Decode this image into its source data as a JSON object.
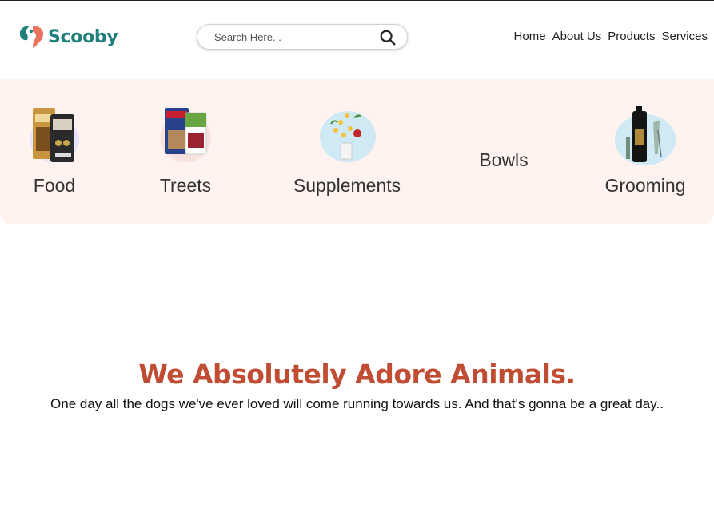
{
  "brand": {
    "name": "Scooby",
    "logo_icon": "heart-paw-logo",
    "primary_color": "#1f7f7a",
    "accent_color": "#e9735d"
  },
  "search": {
    "placeholder": "Search Here. .",
    "icon": "search-icon"
  },
  "nav": {
    "items": [
      {
        "label": "Home"
      },
      {
        "label": "About Us"
      },
      {
        "label": "Products"
      },
      {
        "label": "Services"
      }
    ]
  },
  "categories": {
    "background": "#fef3ef",
    "items": [
      {
        "label": "Food",
        "image": "food-packs"
      },
      {
        "label": "Treets",
        "image": "treat-packs"
      },
      {
        "label": "Supplements",
        "image": "supplement-bottle"
      },
      {
        "label": "Bowls",
        "image": ""
      },
      {
        "label": "Grooming",
        "image": "grooming-kit"
      }
    ]
  },
  "hero": {
    "title": "We Absolutely Adore Animals.",
    "subtitle": "One day all the dogs we've ever loved will come running towards us. And that's gonna be a great day..",
    "title_color": "#c04d33"
  }
}
